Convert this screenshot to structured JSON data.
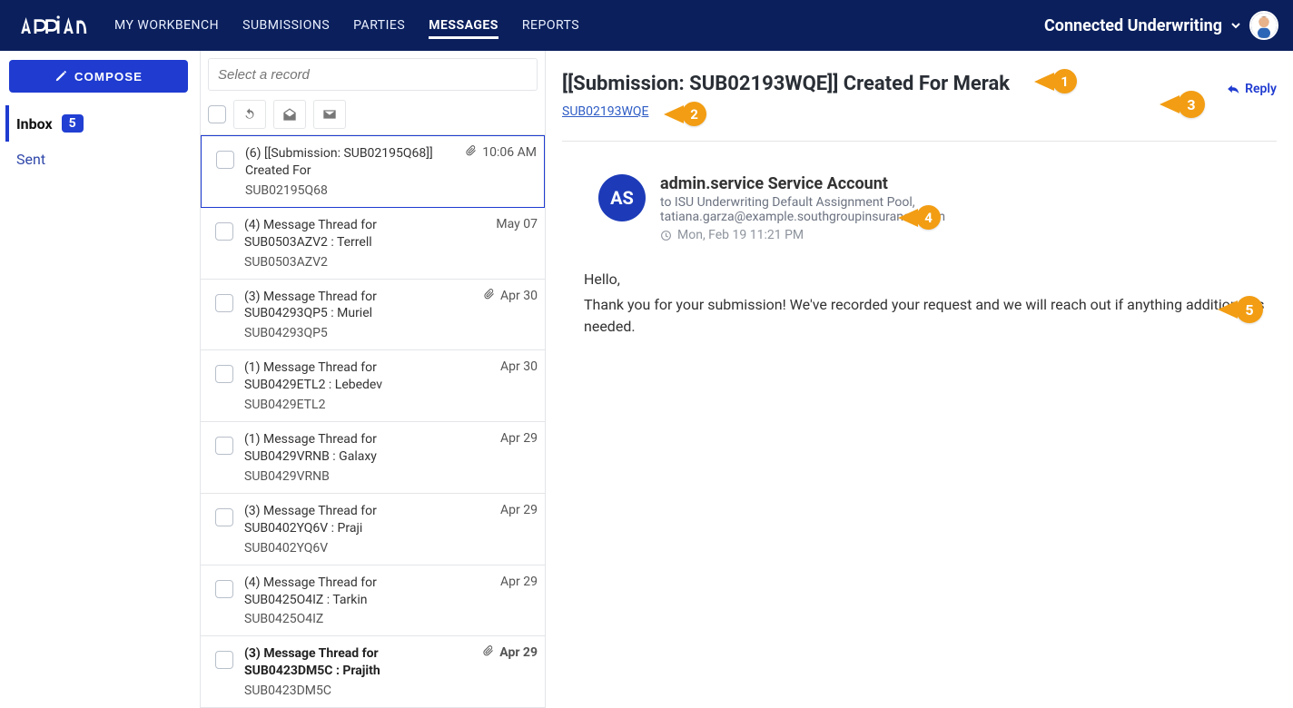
{
  "colors": {
    "navy": "#0a1f5c",
    "blue": "#1f3bd0",
    "callout": "#f29d13"
  },
  "header": {
    "brand": "appian",
    "nav": {
      "my_workbench": "MY WORKBENCH",
      "submissions": "SUBMISSIONS",
      "parties": "PARTIES",
      "messages": "MESSAGES",
      "reports": "REPORTS",
      "active": "messages"
    },
    "workspace": "Connected Underwriting"
  },
  "sidebar": {
    "compose": "COMPOSE",
    "inbox": {
      "label": "Inbox",
      "count": "5"
    },
    "sent": {
      "label": "Sent"
    }
  },
  "list": {
    "search_placeholder": "Select a record",
    "items": [
      {
        "subject": "(6) [[Submission: SUB02195Q68]] Created For",
        "sub": "SUB02195Q68",
        "time": "10:06 AM",
        "attachment": true,
        "selected": true,
        "unread": false
      },
      {
        "subject": "(4) Message Thread for SUB0503AZV2 : Terrell",
        "sub": "SUB0503AZV2",
        "time": "May 07",
        "attachment": false,
        "selected": false,
        "unread": false
      },
      {
        "subject": "(3) Message Thread for SUB04293QP5 : Muriel",
        "sub": "SUB04293QP5",
        "time": "Apr 30",
        "attachment": true,
        "selected": false,
        "unread": false
      },
      {
        "subject": "(1) Message Thread for SUB0429ETL2 : Lebedev",
        "sub": "SUB0429ETL2",
        "time": "Apr 30",
        "attachment": false,
        "selected": false,
        "unread": false
      },
      {
        "subject": "(1) Message Thread for SUB0429VRNB : Galaxy",
        "sub": "SUB0429VRNB",
        "time": "Apr 29",
        "attachment": false,
        "selected": false,
        "unread": false
      },
      {
        "subject": "(3) Message Thread for SUB0402YQ6V : Praji",
        "sub": "SUB0402YQ6V",
        "time": "Apr 29",
        "attachment": false,
        "selected": false,
        "unread": false
      },
      {
        "subject": "(4) Message Thread for SUB0425O4IZ : Tarkin",
        "sub": "SUB0425O4IZ",
        "time": "Apr 29",
        "attachment": false,
        "selected": false,
        "unread": false
      },
      {
        "subject": "(3) Message Thread for SUB0423DM5C : Prajith",
        "sub": "SUB0423DM5C",
        "time": "Apr 29",
        "attachment": true,
        "selected": false,
        "unread": true
      }
    ]
  },
  "detail": {
    "subject": "[[Submission: SUB02193WQE]] Created For Merak",
    "submission_link": "SUB02193WQE",
    "reply": "Reply",
    "sender": {
      "initials": "AS",
      "name": "admin.service Service Account",
      "to_line": "to ISU Underwriting Default Assignment Pool,",
      "email": "tatiana.garza@example.southgroupinsurance.com",
      "time": "Mon, Feb 19 11:21 PM"
    },
    "body_lines": {
      "l1": "Hello,",
      "l2": "Thank you for your submission! We've recorded your request and we will reach out if anything additional is needed."
    }
  },
  "callouts": {
    "c1": "1",
    "c2": "2",
    "c3": "3",
    "c4": "4",
    "c5": "5"
  }
}
